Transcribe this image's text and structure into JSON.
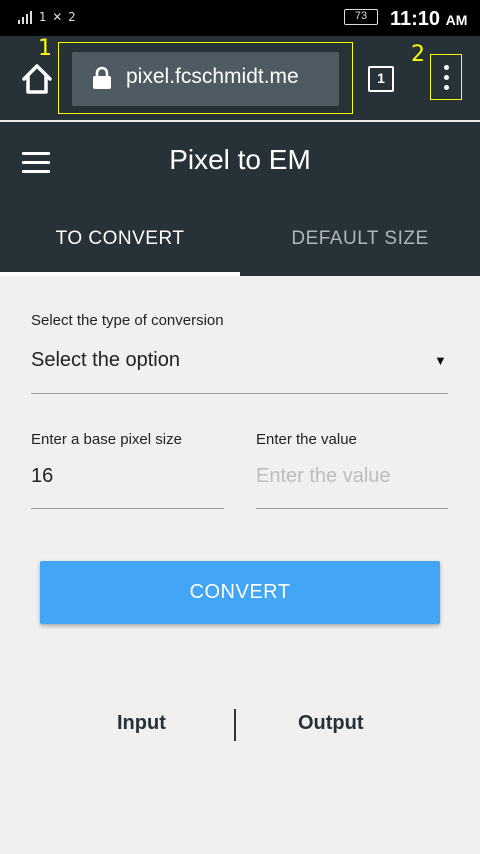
{
  "status_bar": {
    "signal": "1  ✕ 2",
    "battery": "73",
    "time": "11:10",
    "ampm": "AM"
  },
  "browser": {
    "url": "pixel.fcschmidt.me",
    "tab_count": "1",
    "annotations": [
      "1",
      "2"
    ],
    "highlight_color": "#ffff00"
  },
  "app": {
    "title": "Pixel to EM",
    "tabs": [
      {
        "label": "TO CONVERT",
        "active": true
      },
      {
        "label": "DEFAULT SIZE",
        "active": false
      }
    ],
    "primary_color": "#263238"
  },
  "form": {
    "conversion_label": "Select the type of conversion",
    "conversion_value": "Select the option",
    "base_label": "Enter a base pixel size",
    "base_value": "16",
    "value_label": "Enter the value",
    "value_placeholder": "Enter the value",
    "convert_label": "CONVERT",
    "button_color": "#42a5f5"
  },
  "results": {
    "input_label": "Input",
    "output_label": "Output"
  },
  "icons": [
    "home-icon",
    "lock-icon",
    "tabs-icon",
    "more-vert-icon",
    "menu-icon",
    "dropdown-arrow-icon"
  ]
}
